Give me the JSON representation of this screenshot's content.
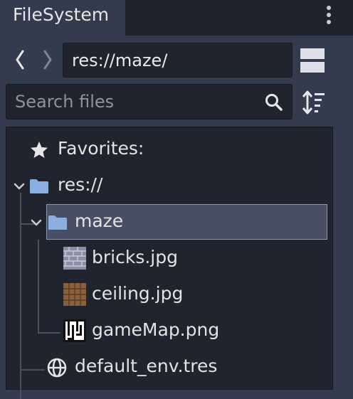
{
  "panel": {
    "tab_title": "FileSystem"
  },
  "navigation": {
    "current_path": "res://maze/"
  },
  "search": {
    "placeholder": "Search files"
  },
  "tree": {
    "favorites_label": "Favorites:",
    "root_label": "res://",
    "selected_folder": "maze",
    "files": [
      {
        "name": "bricks.jpg",
        "icon": "bricks-thumbnail-icon"
      },
      {
        "name": "ceiling.jpg",
        "icon": "ceiling-thumbnail-icon"
      },
      {
        "name": "gameMap.png",
        "icon": "gamemap-thumbnail-icon"
      }
    ],
    "root_file": {
      "name": "default_env.tres",
      "icon": "globe-icon"
    }
  },
  "colors": {
    "background": "#333b4f",
    "field": "#20242f",
    "folder": "#8aafe0",
    "selection": "#464f63"
  }
}
